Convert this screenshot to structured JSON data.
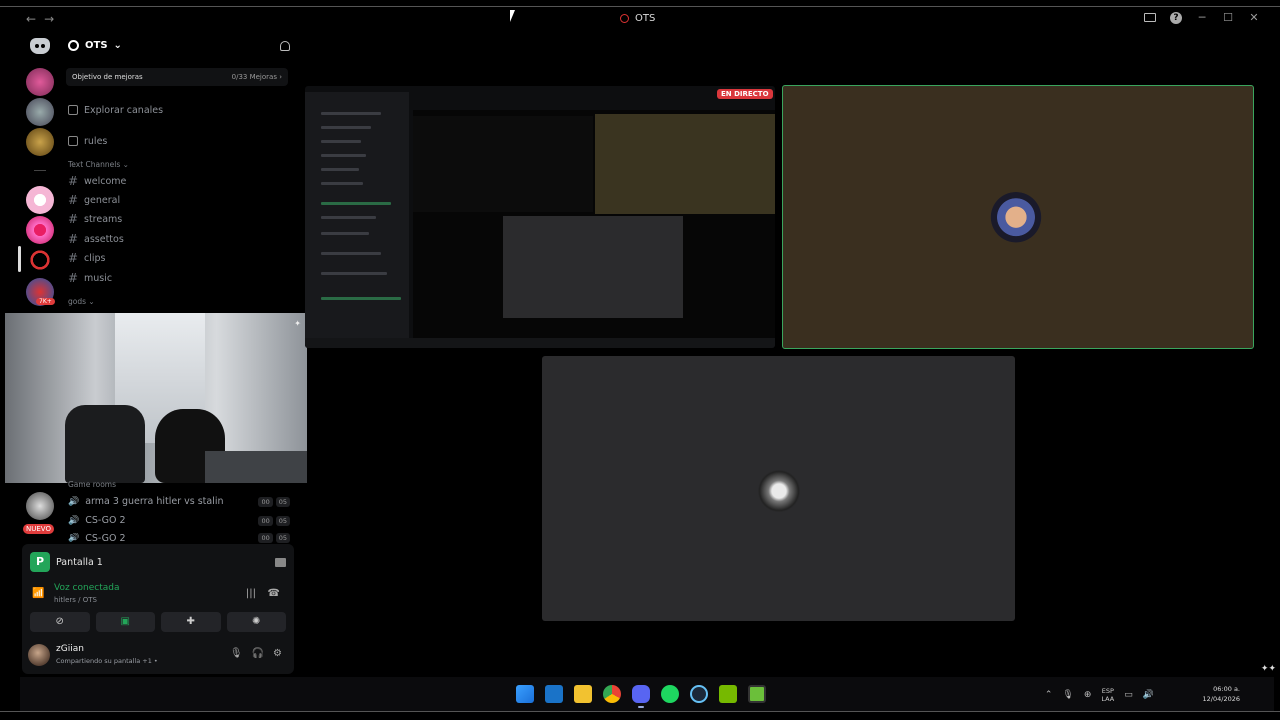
{
  "window": {
    "title": "OTS",
    "nav_back": "←",
    "nav_forward": "→",
    "minimize": "─",
    "maximize": "☐",
    "close": "✕",
    "help": "?"
  },
  "server": {
    "name": "OTS",
    "boost": {
      "label": "Objetivo de mejoras",
      "progress": "0/33 Mejoras ›"
    },
    "explore": "Explorar canales",
    "rules": "rules",
    "text_category": "Text Channels ⌄",
    "text_channels": [
      "welcome",
      "general",
      "streams",
      "assettos",
      "clips",
      "music"
    ],
    "gods_category": "gods ⌄",
    "game_category": "Game rooms",
    "voice_channels": [
      {
        "name": "arma 3 guerra hitler vs stalin",
        "c1": "00",
        "c2": "05"
      },
      {
        "name": "CS-GO 2",
        "c1": "00",
        "c2": "05"
      },
      {
        "name": "CS-GO 2",
        "c1": "00",
        "c2": "05"
      }
    ]
  },
  "rail": {
    "badge": "7K+",
    "nuevo": "NUEVO"
  },
  "stream_panel": {
    "screen_label": "Pantalla 1",
    "screen_letter": "P"
  },
  "voice": {
    "status": "Voz conectada",
    "channel": "hitlers / OTS"
  },
  "controls": {
    "cam": "⊘",
    "share": "▣",
    "activity": "✚",
    "soundboard": "✺"
  },
  "user": {
    "name": "zGiian",
    "status": "Compartiendo su pantalla +1 •",
    "mic": "🎙",
    "headset": "🎧",
    "settings": "⚙"
  },
  "live_badge": "EN DIRECTO",
  "tray": {
    "lang1": "ESP",
    "lang2": "LAA",
    "time": "06:00 a.",
    "date": "12/04/2026"
  },
  "taskbar_apps": [
    "windows-start",
    "outlook",
    "file-explorer",
    "chrome",
    "discord",
    "spotify",
    "steam",
    "nvidia",
    "green-app"
  ],
  "colors": {
    "accent_green": "#23a559",
    "live_red": "#da373c",
    "olive_tile": "#3a2f1f"
  }
}
